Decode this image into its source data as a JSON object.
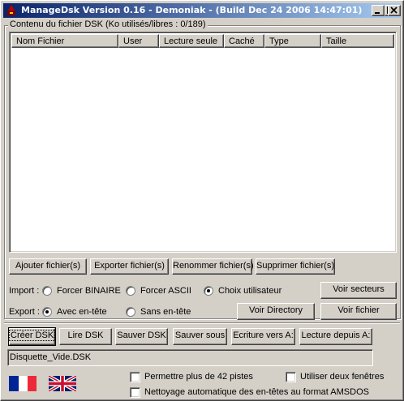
{
  "window": {
    "title": "ManageDsk Version 0.16 - Demoniak - (Build Dec 24 2006 14:47:01)",
    "controls": {
      "minimize": "_",
      "maximize": "□",
      "close": "✕"
    }
  },
  "group": {
    "title": "Contenu du fichier DSK (Ko utilisés/libres : 0/189)"
  },
  "table": {
    "columns": [
      "Nom Fichier",
      "User",
      "Lecture seule",
      "Caché",
      "Type",
      "Taille"
    ],
    "rows": []
  },
  "file_actions": {
    "add": "Ajouter fichier(s)",
    "export": "Exporter fichier(s)",
    "rename": "Renommer fichier(s)",
    "delete": "Supprimer fichier(s)"
  },
  "import": {
    "label": "Import :",
    "options": [
      "Forcer BINAIRE",
      "Forcer ASCII",
      "Choix utilisateur"
    ],
    "selected": "Choix utilisateur"
  },
  "export": {
    "label": "Export :",
    "options": [
      "Avec en-tête",
      "Sans en-tête"
    ],
    "selected": "Avec en-tête"
  },
  "view_buttons": {
    "sectors": "Voir secteurs",
    "directory": "Voir Directory",
    "file": "Voir fichier"
  },
  "disk_actions": {
    "create": "Créer DSK",
    "read": "Lire DSK",
    "save": "Sauver DSK",
    "save_as": "Sauver sous",
    "write_a": "Ecriture vers A:",
    "read_a": "Lecture depuis A:"
  },
  "filename": {
    "value": "Disquette_Vide.DSK"
  },
  "options": {
    "more_tracks": {
      "label": "Permettre plus de 42 pistes",
      "checked": false
    },
    "two_windows": {
      "label": "Utiliser deux fenêtres",
      "checked": false
    },
    "auto_clean": {
      "label": "Nettoyage automatique des en-têtes au format AMSDOS",
      "checked": false
    }
  },
  "languages": [
    {
      "name": "french-flag-icon",
      "colors": [
        "#002395",
        "#ffffff",
        "#ed2939"
      ]
    },
    {
      "name": "uk-flag-icon",
      "colors": [
        "#012169",
        "#ffffff",
        "#c8102e"
      ]
    }
  ]
}
